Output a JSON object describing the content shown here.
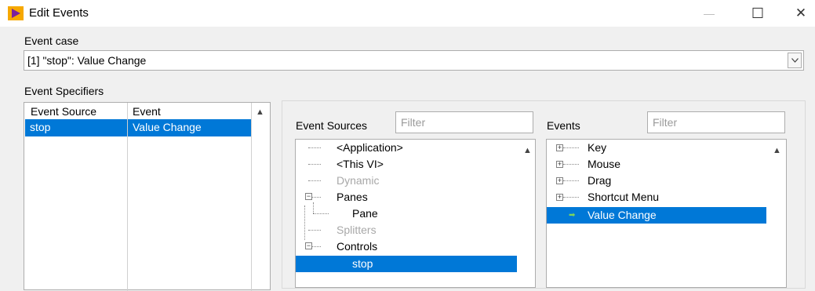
{
  "window": {
    "title": "Edit Events",
    "controls": {
      "minimize": "—",
      "maximize": "☐",
      "close": "✕"
    }
  },
  "event_case": {
    "label": "Event case",
    "value": "[1] \"stop\": Value Change"
  },
  "event_specifiers": {
    "label": "Event Specifiers",
    "columns": [
      "Event Source",
      "Event"
    ],
    "rows": [
      {
        "source": "stop",
        "event": "Value Change"
      }
    ]
  },
  "event_sources": {
    "label": "Event Sources",
    "filter_placeholder": "Filter",
    "items": [
      {
        "label": "<Application>"
      },
      {
        "label": "<This VI>"
      },
      {
        "label": "Dynamic"
      },
      {
        "label": "Panes"
      },
      {
        "label": "Pane"
      },
      {
        "label": "Splitters"
      },
      {
        "label": "Controls"
      },
      {
        "label": "stop"
      }
    ]
  },
  "events": {
    "label": "Events",
    "filter_placeholder": "Filter",
    "items": [
      {
        "label": "Key"
      },
      {
        "label": "Mouse"
      },
      {
        "label": "Drag"
      },
      {
        "label": "Shortcut Menu"
      },
      {
        "label": "Value Change"
      }
    ]
  }
}
